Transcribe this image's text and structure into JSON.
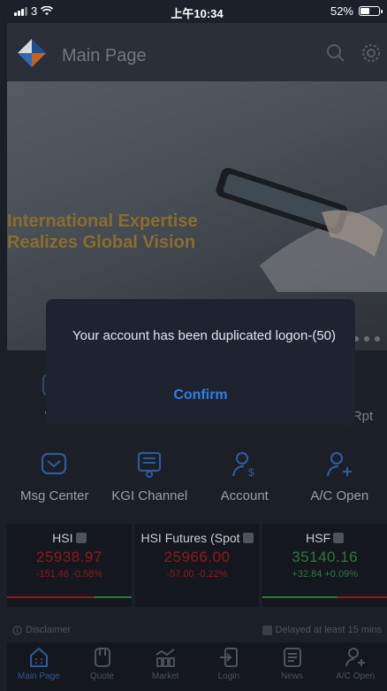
{
  "status_bar": {
    "carrier": "3",
    "time": "上午10:34",
    "battery": "52%",
    "battery_level": 0.52
  },
  "header": {
    "title": "Main Page",
    "icons": [
      "search-icon",
      "settings-icon"
    ]
  },
  "banner": {
    "headline_line1": "International Expertise",
    "headline_line2": "Realizes Global Vision",
    "slide_count": 3
  },
  "functions": {
    "row1": [
      {
        "label": "Wa",
        "icon": "wallet-icon"
      },
      {
        "label": "",
        "icon": "hidden-icon"
      },
      {
        "label": "",
        "icon": "hidden-icon"
      },
      {
        "label": "n Rpt",
        "icon": "report-icon"
      }
    ],
    "row2": [
      {
        "label": "Msg Center",
        "icon": "message-icon"
      },
      {
        "label": "KGI Channel",
        "icon": "channel-icon"
      },
      {
        "label": "Account",
        "icon": "account-icon"
      },
      {
        "label": "A/C Open",
        "icon": "add-user-icon"
      }
    ]
  },
  "indices": [
    {
      "name": "HSI",
      "value": "25938.97",
      "change": "-151.46 -0.58%",
      "trend": "down"
    },
    {
      "name": "HSI Futures (Spot",
      "value": "25966.00",
      "change": "-57.00 -0.22%",
      "trend": "down"
    },
    {
      "name": "HSF",
      "value": "35140.16",
      "change": "+32.84 +0.09%",
      "trend": "up"
    }
  ],
  "disclaimer": {
    "left": "Disclaimer",
    "right": "Delayed at least 15 mins"
  },
  "tab_bar": [
    {
      "label": "Main Page",
      "icon": "home-icon",
      "active": true
    },
    {
      "label": "Quote",
      "icon": "quote-icon",
      "active": false
    },
    {
      "label": "Market",
      "icon": "market-icon",
      "active": false
    },
    {
      "label": "Login",
      "icon": "login-icon",
      "active": false
    },
    {
      "label": "News",
      "icon": "news-icon",
      "active": false
    },
    {
      "label": "A/C Open",
      "icon": "add-user-icon",
      "active": false
    }
  ],
  "dialog": {
    "message": "Your account has been duplicated logon-(50)",
    "confirm_label": "Confirm"
  },
  "colors": {
    "accent": "#2f7fe0",
    "down": "#8c1c1c",
    "up": "#2a7a3e",
    "banner_text": "#8a6d2d"
  }
}
